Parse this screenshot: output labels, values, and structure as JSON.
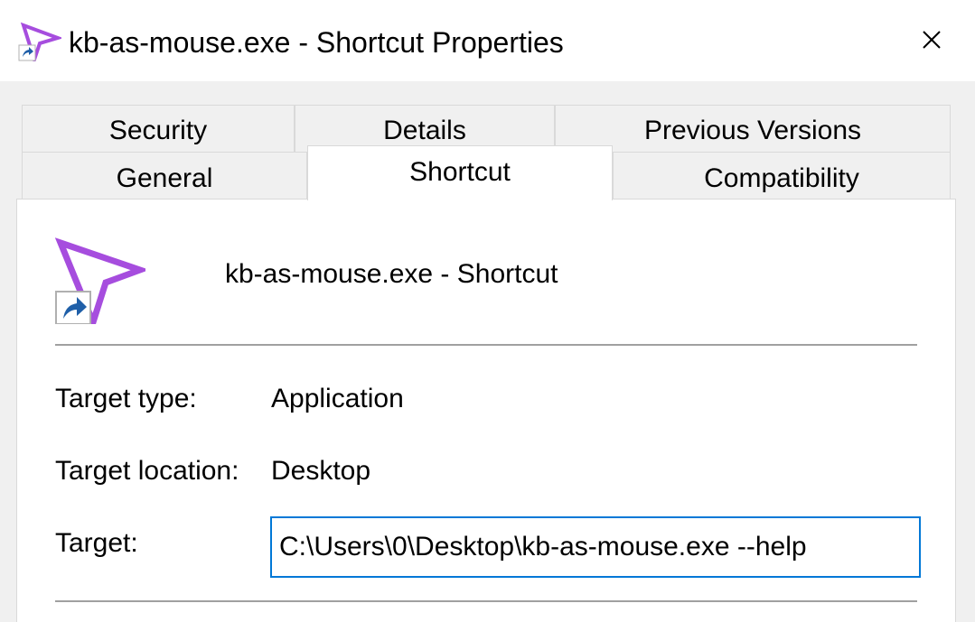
{
  "window": {
    "title": "kb-as-mouse.exe - Shortcut Properties",
    "app_icon": "purple-cursor-shortcut-icon",
    "close_icon": "close-icon",
    "accent": "#0078d7",
    "icon_color": "#a64dde"
  },
  "tabs": {
    "row1": [
      {
        "label": "Security"
      },
      {
        "label": "Details"
      },
      {
        "label": "Previous Versions"
      }
    ],
    "row2": [
      {
        "label": "General"
      },
      {
        "label": "Shortcut",
        "active": true
      },
      {
        "label": "Compatibility"
      }
    ]
  },
  "shortcut": {
    "name": "kb-as-mouse.exe - Shortcut",
    "icon": "purple-cursor-shortcut-icon",
    "target_type_label": "Target type:",
    "target_type_value": "Application",
    "target_location_label": "Target location:",
    "target_location_value": "Desktop",
    "target_label": "Target:",
    "target_value": "C:\\Users\\0\\Desktop\\kb-as-mouse.exe --help"
  }
}
